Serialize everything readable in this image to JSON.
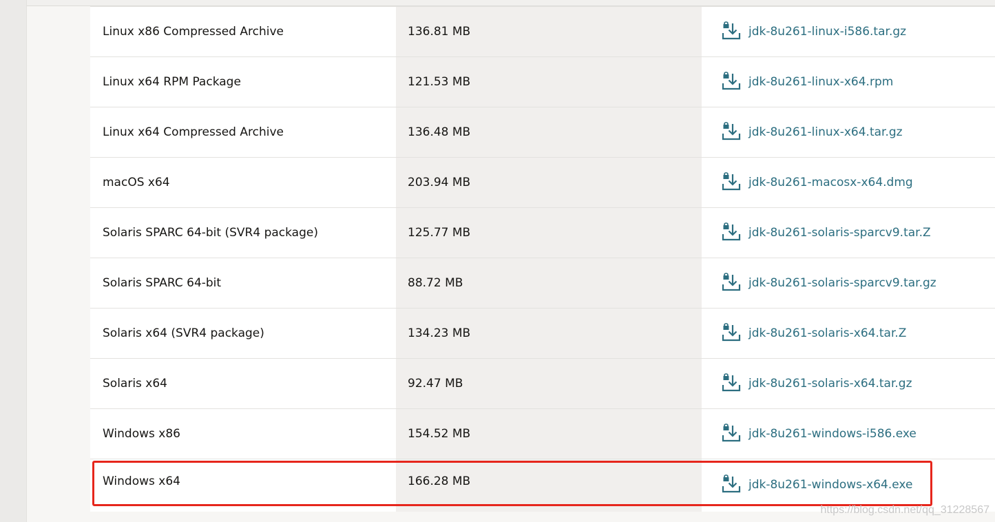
{
  "rows": [
    {
      "product": "Linux x86 Compressed Archive",
      "size": "136.81 MB",
      "file": "jdk-8u261-linux-i586.tar.gz"
    },
    {
      "product": "Linux x64 RPM Package",
      "size": "121.53 MB",
      "file": "jdk-8u261-linux-x64.rpm"
    },
    {
      "product": "Linux x64 Compressed Archive",
      "size": "136.48 MB",
      "file": "jdk-8u261-linux-x64.tar.gz"
    },
    {
      "product": "macOS x64",
      "size": "203.94 MB",
      "file": "jdk-8u261-macosx-x64.dmg"
    },
    {
      "product": "Solaris SPARC 64-bit (SVR4 package)",
      "size": "125.77 MB",
      "file": "jdk-8u261-solaris-sparcv9.tar.Z"
    },
    {
      "product": "Solaris SPARC 64-bit",
      "size": "88.72 MB",
      "file": "jdk-8u261-solaris-sparcv9.tar.gz"
    },
    {
      "product": "Solaris x64 (SVR4 package)",
      "size": "134.23 MB",
      "file": "jdk-8u261-solaris-x64.tar.Z"
    },
    {
      "product": "Solaris x64",
      "size": "92.47 MB",
      "file": "jdk-8u261-solaris-x64.tar.gz"
    },
    {
      "product": "Windows x86",
      "size": "154.52 MB",
      "file": "jdk-8u261-windows-i586.exe"
    },
    {
      "product": "Windows x64",
      "size": "166.28 MB",
      "file": "jdk-8u261-windows-x64.exe"
    }
  ],
  "icons": {
    "download": "download-lock-icon"
  },
  "colors": {
    "link": "#2c6e80",
    "highlight": "#e6261c",
    "size_column_bg": "#f1efed"
  },
  "watermark": "https://blog.csdn.net/qq_31228567"
}
